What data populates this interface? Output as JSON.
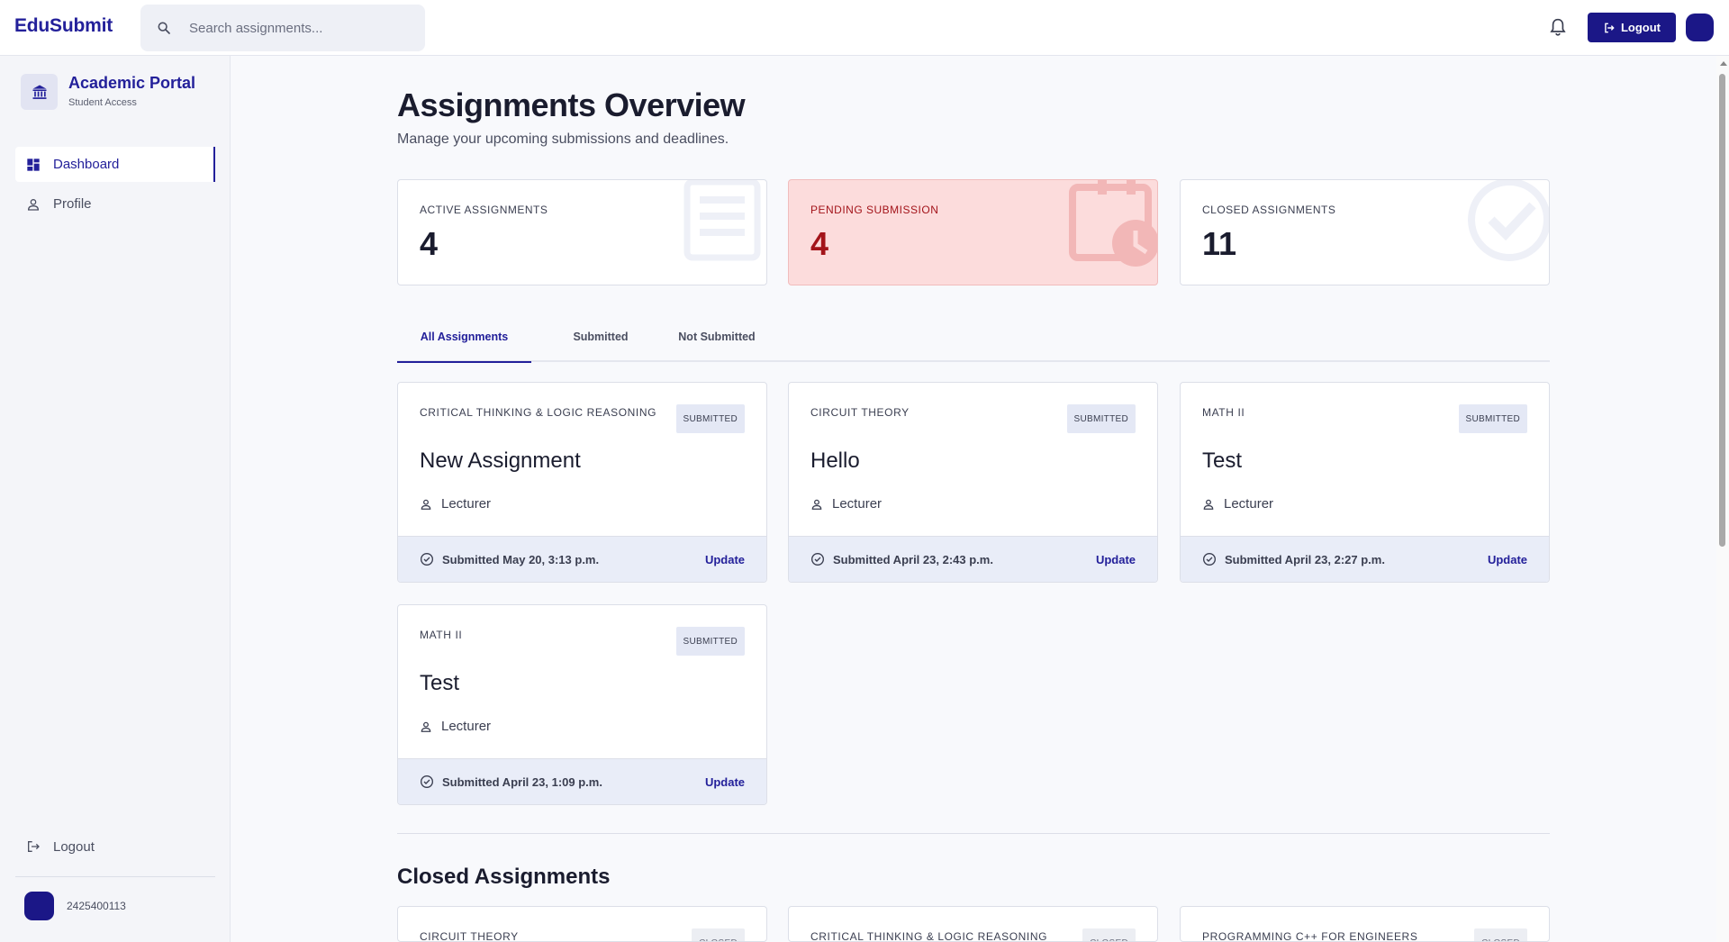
{
  "app": {
    "brand": "EduSubmit"
  },
  "search": {
    "placeholder": "Search assignments..."
  },
  "header": {
    "logout_label": "Logout"
  },
  "sidebar": {
    "portal_title": "Academic Portal",
    "portal_subtitle": "Student Access",
    "items": [
      {
        "label": "Dashboard",
        "icon": "dashboard-icon",
        "active": true
      },
      {
        "label": "Profile",
        "icon": "person-icon",
        "active": false
      }
    ],
    "logout_label": "Logout",
    "user_id": "2425400113"
  },
  "page": {
    "title": "Assignments Overview",
    "subtitle": "Manage your upcoming submissions and deadlines."
  },
  "stats": [
    {
      "label": "ACTIVE ASSIGNMENTS",
      "value": "4",
      "icon": "document-icon"
    },
    {
      "label": "PENDING SUBMISSION",
      "value": "4",
      "icon": "calendar-clock-icon"
    },
    {
      "label": "CLOSED ASSIGNMENTS",
      "value": "11",
      "icon": "check-circle-icon"
    }
  ],
  "tabs": [
    {
      "label": "All Assignments",
      "active": true
    },
    {
      "label": "Submitted",
      "active": false
    },
    {
      "label": "Not Submitted",
      "active": false
    }
  ],
  "assignments": [
    {
      "course": "CRITICAL THINKING & LOGIC REASONING",
      "badge": "SUBMITTED",
      "title": "New Assignment",
      "lecturer": "Lecturer",
      "status": "Submitted May 20, 3:13 p.m.",
      "action": "Update"
    },
    {
      "course": "CIRCUIT THEORY",
      "badge": "SUBMITTED",
      "title": "Hello",
      "lecturer": "Lecturer",
      "status": "Submitted April 23, 2:43 p.m.",
      "action": "Update"
    },
    {
      "course": "MATH II",
      "badge": "SUBMITTED",
      "title": "Test",
      "lecturer": "Lecturer",
      "status": "Submitted April 23, 2:27 p.m.",
      "action": "Update"
    },
    {
      "course": "MATH II",
      "badge": "SUBMITTED",
      "title": "Test",
      "lecturer": "Lecturer",
      "status": "Submitted April 23, 1:09 p.m.",
      "action": "Update"
    }
  ],
  "closed": {
    "title": "Closed Assignments",
    "items": [
      {
        "course": "CIRCUIT THEORY",
        "badge": "CLOSED"
      },
      {
        "course": "CRITICAL THINKING & LOGIC REASONING",
        "badge": "CLOSED"
      },
      {
        "course": "PROGRAMMING C++ FOR ENGINEERS",
        "badge": "CLOSED"
      }
    ]
  },
  "colors": {
    "brand": "#23209a",
    "primary_button": "#1b1787",
    "pending_bg": "#fcdcdc",
    "pending_text": "#a3141a"
  }
}
